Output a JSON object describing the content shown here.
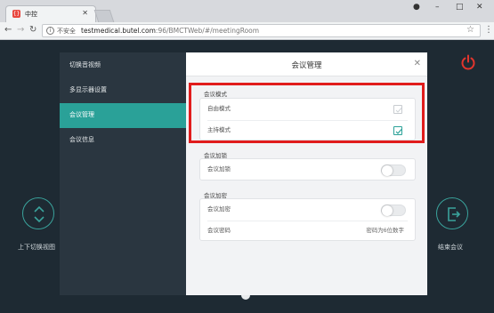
{
  "browser": {
    "tab_title": "中控",
    "tab_favicon": "{}",
    "security_label": "不安全",
    "url_host": "testmedical.butel.com",
    "url_rest": ":96/BMCTWeb/#/meetingRoom"
  },
  "app": {
    "left_action_label": "上下切换视图",
    "right_action_label": "结束会议"
  },
  "sidebar": {
    "items": [
      {
        "label": "切换音视频"
      },
      {
        "label": "多显示器设置"
      },
      {
        "label": "会议管理"
      },
      {
        "label": "会议信息"
      }
    ],
    "active_index": 2
  },
  "panel": {
    "title": "会议管理",
    "mode_section": {
      "title": "会议模式",
      "free_mode": {
        "label": "自由模式",
        "checked": false
      },
      "host_mode": {
        "label": "主持模式",
        "checked": true
      }
    },
    "lock_section": {
      "title": "会议加锁",
      "lock": {
        "label": "会议加锁",
        "on": false
      }
    },
    "encrypt_section": {
      "title": "会议加密",
      "encrypt": {
        "label": "会议加密",
        "on": false
      },
      "password": {
        "label": "会议密码",
        "value": "密码为6位数字"
      }
    }
  },
  "colors": {
    "accent": "#2aa198",
    "highlight": "#e11c1c",
    "power": "#e2352d"
  }
}
